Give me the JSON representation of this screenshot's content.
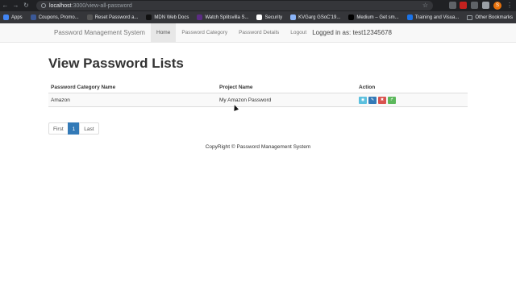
{
  "browser": {
    "url_host": "localhost",
    "url_path": ":3000/view-all-password",
    "avatar_letter": "S",
    "bookmarks": [
      {
        "label": "Apps",
        "color": "#4285f4"
      },
      {
        "label": "Coupons, Promo...",
        "color": "#3b5998"
      },
      {
        "label": "Reset Password a...",
        "color": "#555555"
      },
      {
        "label": "MDN Web Docs",
        "color": "#111111"
      },
      {
        "label": "Watch Splitsvilla S...",
        "color": "#5b2c83"
      },
      {
        "label": "Security",
        "color": "#ffffff"
      },
      {
        "label": "KVGarg GSoC'19...",
        "color": "#8ab4f8"
      },
      {
        "label": "Medium – Get sm...",
        "color": "#000000"
      },
      {
        "label": "Training and Visua...",
        "color": "#1a73e8"
      }
    ],
    "other_bookmarks": "Other Bookmarks"
  },
  "navbar": {
    "brand": "Password Management System",
    "links": [
      "Home",
      "Password Category",
      "Password Details",
      "Logout"
    ],
    "logged_in": "Logged in as: test12345678"
  },
  "main": {
    "title": "View Password Lists",
    "columns": [
      "Password Category Name",
      "Project Name",
      "Action"
    ],
    "rows": [
      {
        "category": "Amazon",
        "project": "My Amazon Password"
      }
    ],
    "action_colors": {
      "view": "#5bc0de",
      "edit": "#337ab7",
      "delete": "#d9534f",
      "share": "#5cb85c"
    },
    "pagination": [
      "First",
      "1",
      "Last"
    ]
  },
  "footer": "CopyRight © Password Management System"
}
